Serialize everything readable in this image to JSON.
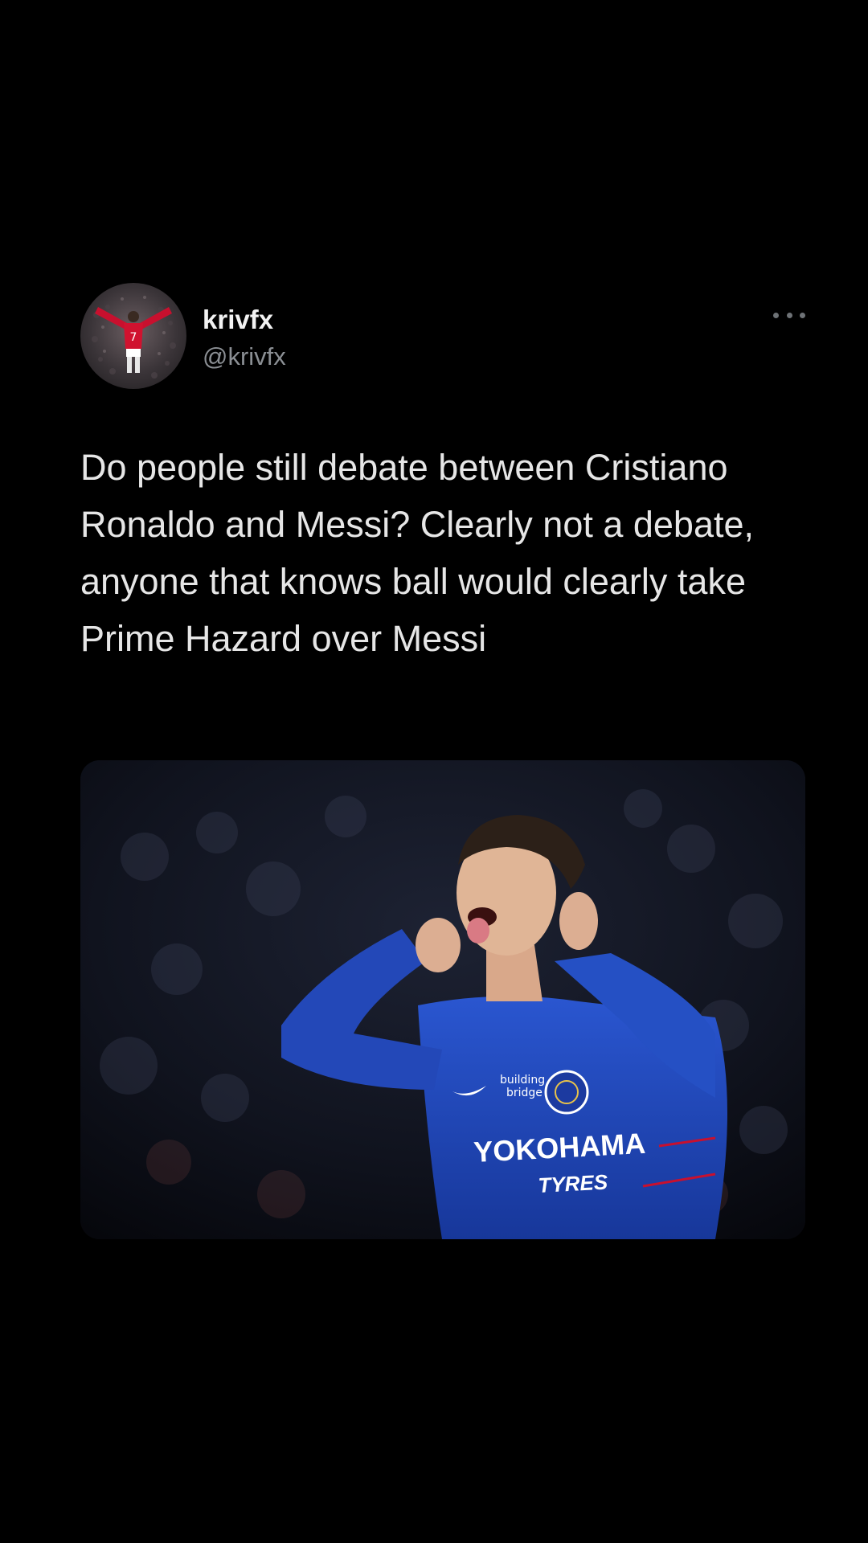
{
  "tweet": {
    "display_name": "krivfx",
    "handle": "@krivfx",
    "text": "Do people still debate between Cristiano Ronaldo and Messi? Clearly not a debate, anyone that knows ball would clearly take Prime Hazard over Messi",
    "more_icon": "more-horizontal-icon",
    "avatar": {
      "jersey_number": "7"
    },
    "media": {
      "sponsor_line1": "YOKOHAMA",
      "sponsor_line2": "TYRES",
      "sleeve_text_line1": "building",
      "sleeve_text_line2": "bridge"
    }
  },
  "colors": {
    "background": "#000000",
    "text_primary": "#e7e9ea",
    "text_secondary": "#8b8f94",
    "jersey_blue": "#1f47b8"
  }
}
